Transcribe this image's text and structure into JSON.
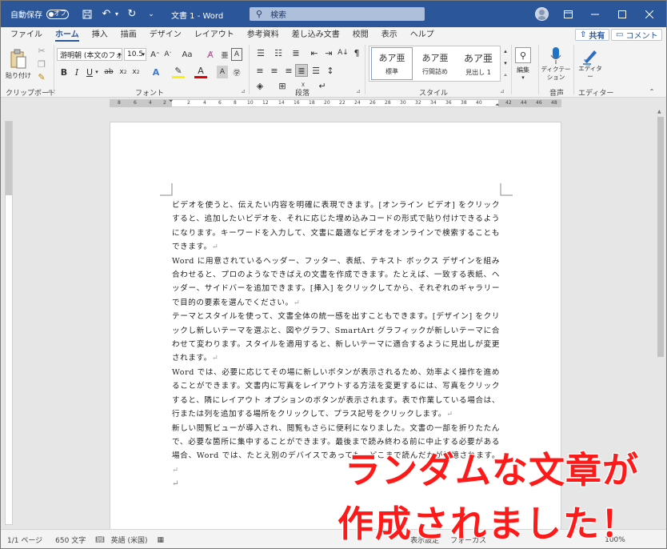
{
  "titlebar": {
    "autosave_label": "自動保存",
    "autosave_state": "オフ",
    "doc_title": "文書 1  -  Word",
    "search_placeholder": "検索"
  },
  "tabs": [
    "ファイル",
    "ホーム",
    "挿入",
    "描画",
    "デザイン",
    "レイアウト",
    "参考資料",
    "差し込み文書",
    "校閲",
    "表示",
    "ヘルプ"
  ],
  "active_tab": "ホーム",
  "share_label": "共有",
  "comment_label": "コメント",
  "ribbon": {
    "clipboard": {
      "paste_label": "貼り付け",
      "group_label": "クリップボード"
    },
    "font": {
      "font_name": "游明朝 (本文のフォ",
      "font_size": "10.5",
      "group_label": "フォント"
    },
    "paragraph": {
      "group_label": "段落"
    },
    "styles": {
      "items": [
        {
          "sample": "あア亜",
          "name": "標準"
        },
        {
          "sample": "あア亜",
          "name": "行間詰め"
        },
        {
          "sample": "あア亜",
          "name": "見出し 1"
        }
      ],
      "group_label": "スタイル"
    },
    "editing": {
      "label": "編集"
    },
    "voice": {
      "dictate_label": "ディクテーション",
      "group_label": "音声"
    },
    "editor": {
      "label": "エディター",
      "group_label": "エディター"
    }
  },
  "ruler": {
    "left_marks": [
      "8",
      "6",
      "4",
      "2"
    ],
    "marks": [
      "2",
      "4",
      "6",
      "8",
      "10",
      "12",
      "14",
      "16",
      "18",
      "20",
      "22",
      "24",
      "26",
      "28",
      "30",
      "32",
      "34",
      "36",
      "38",
      "40"
    ],
    "right_marks": [
      "42",
      "44",
      "46",
      "48"
    ]
  },
  "document": {
    "paragraphs": [
      "ビデオを使うと、伝えたい内容を明確に表現できます。[オンライン ビデオ] をクリックすると、追加したいビデオを、それに応じた埋め込みコードの形式で貼り付けできるようになります。キーワードを入力して、文書に最適なビデオをオンラインで検索することもできます。",
      "Word に用意されているヘッダー、フッター、表紙、テキスト ボックス デザインを組み合わせると、プロのようなできばえの文書を作成できます。たとえば、一致する表紙、ヘッダー、サイドバーを追加できます。[挿入] をクリックしてから、それぞれのギャラリーで目的の要素を選んでください。",
      "テーマとスタイルを使って、文書全体の統一感を出すこともできます。[デザイン] をクリックし新しいテーマを選ぶと、図やグラフ、SmartArt グラフィックが新しいテーマに合わせて変わります。スタイルを適用すると、新しいテーマに適合するように見出しが変更されます。",
      "Word では、必要に応じてその場に新しいボタンが表示されるため、効率よく操作を進めることができます。文書内に写真をレイアウトする方法を変更するには、写真をクリックすると、隣にレイアウト オプションのボタンが表示されます。表で作業している場合は、行または列を追加する場所をクリックして、プラス記号をクリックします。",
      "新しい閲覧ビューが導入され、閲覧もさらに便利になりました。文書の一部を折りたたんで、必要な箇所に集中することができます。最後まで読み終わる前に中止する必要がある場合、Word では、たとえ別のデバイスであっても、どこまで読んだかが記憶されます。"
    ],
    "para_mark": "↵"
  },
  "statusbar": {
    "page": "1/1 ページ",
    "words": "650 文字",
    "language": "英語 (米国)",
    "display_settings": "表示設定",
    "focus": "フォーカス",
    "zoom": "100%"
  },
  "annotation": {
    "line1": "ランダムな文章が",
    "line2": "作成されました！"
  }
}
